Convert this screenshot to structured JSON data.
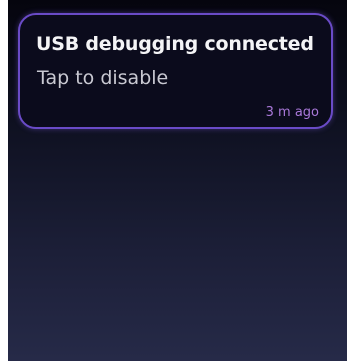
{
  "notification": {
    "title": "USB debugging connected",
    "subtitle": "Tap to disable",
    "time": "3 m ago"
  },
  "colors": {
    "card_border": "#6a4bc7",
    "card_background": "#0b0b1c",
    "time_text": "#a978d9",
    "screen_top": "#05050e",
    "screen_bottom": "#262a48"
  }
}
